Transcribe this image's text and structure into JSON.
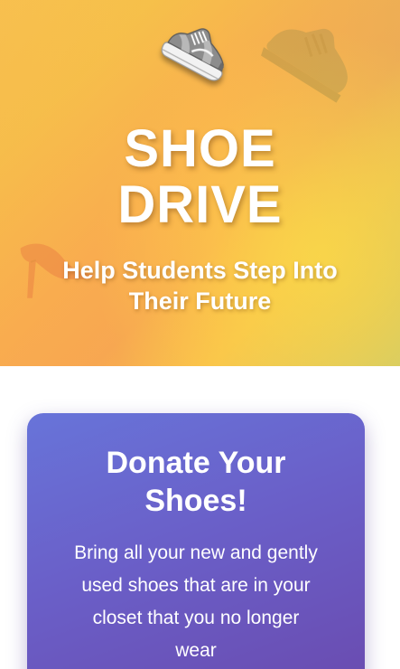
{
  "hero": {
    "title_line1": "SHOE",
    "title_line2": "DRIVE",
    "subtitle_line1": "Help Students Step Into",
    "subtitle_line2": "Their Future"
  },
  "card": {
    "title_line1": "Donate Your",
    "title_line2": "Shoes!",
    "body_line1": "Bring all your new and gently",
    "body_line2": "used shoes that are in your",
    "body_line3": "closet that you no longer",
    "body_line4": "wear"
  },
  "icons": {
    "main": "sneaker-icon",
    "ghost_top_right": "sneaker-icon",
    "ghost_left": "high-heel-icon"
  },
  "colors": {
    "hero_gradient_start": "#f7c44e",
    "hero_gradient_mid": "#f9ad4f",
    "hero_gradient_end": "#cfc96b",
    "card_gradient_start": "#6874d9",
    "card_gradient_end": "#6a4aae",
    "text": "#ffffff"
  }
}
